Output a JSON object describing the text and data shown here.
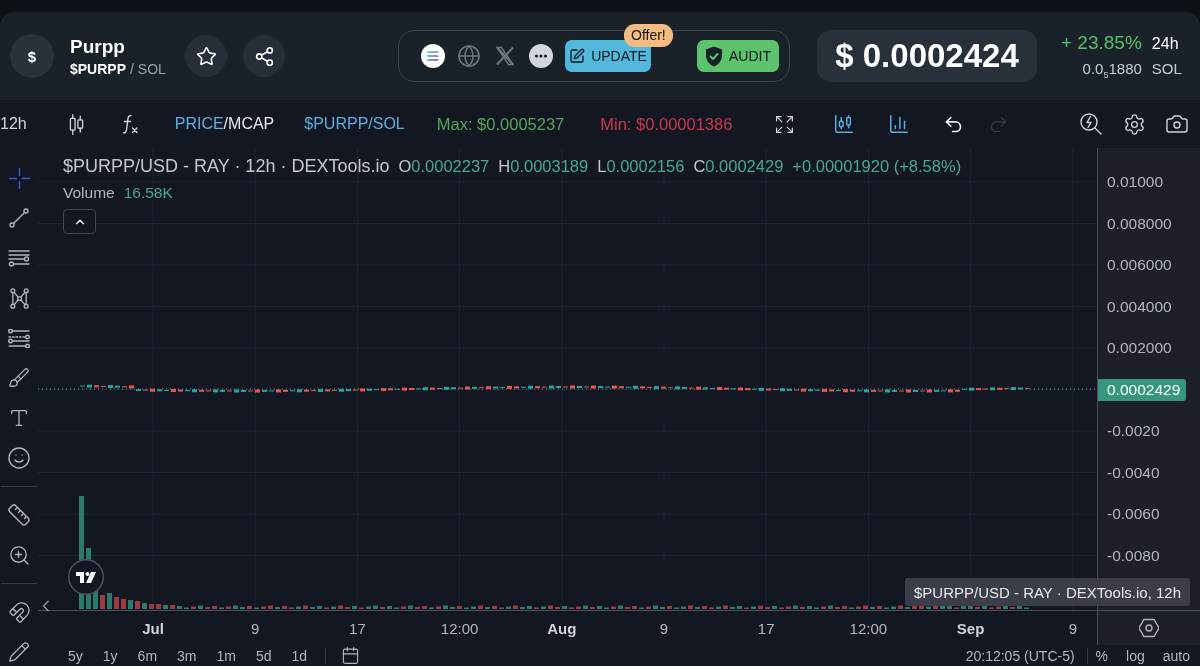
{
  "token": {
    "avatar_text": "$",
    "name": "Purpp",
    "ticker": "$PURPP",
    "quote": "/ SOL"
  },
  "actions": [
    {
      "kind": "update",
      "label": "UPDATE",
      "badge": "Offer!"
    },
    {
      "kind": "audit",
      "label": "AUDIT"
    }
  ],
  "price": {
    "value": "$ 0.0002424",
    "change": "+ 23.85%",
    "period": "24h",
    "native_value": "0.0$_{5}$1880",
    "native_unit": "SOL"
  },
  "toolbar": {
    "interval": "12h",
    "modes": [
      {
        "label": "PRICE",
        "selected": true
      },
      {
        "label": "/MCAP",
        "selected": false
      }
    ],
    "pair": "$PURPP/SOL",
    "max": "Max: $0.0005237",
    "min": "Min: $0.00001386",
    "toggles": [
      {
        "kind": "candles",
        "on": true
      },
      {
        "kind": "volume",
        "on": true
      }
    ],
    "history": [
      {
        "kind": "undo",
        "disabled": false
      },
      {
        "kind": "redo",
        "disabled": true
      }
    ]
  },
  "drawing_tools": [
    [
      {
        "kind": "crosshair",
        "selected": true
      },
      {
        "kind": "trend_line",
        "selected": false
      },
      {
        "kind": "horizontal_lines",
        "selected": false
      },
      {
        "kind": "pattern",
        "selected": false
      },
      {
        "kind": "fib",
        "selected": false
      },
      {
        "kind": "brush",
        "selected": false
      },
      {
        "kind": "text",
        "selected": false
      },
      {
        "kind": "emoji",
        "selected": false
      }
    ],
    [
      {
        "kind": "ruler",
        "selected": false
      },
      {
        "kind": "zoom",
        "selected": false
      }
    ],
    [
      {
        "kind": "magnet",
        "selected": false
      },
      {
        "kind": "pencil",
        "selected": false
      }
    ]
  ],
  "legend": {
    "title": "$PURPP/USD - RAY · 12h · DEXTools.io",
    "ohlc": [
      {
        "label": "O",
        "value": "0.0002237"
      },
      {
        "label": "H",
        "value": "0.0003189"
      },
      {
        "label": "L",
        "value": "0.0002156"
      },
      {
        "label": "C",
        "value": "0.0002429"
      }
    ],
    "change": "+0.00001920 (+8.58%)",
    "volume": {
      "label": "Volume",
      "value": "16.58K"
    }
  },
  "price_axis": [
    {
      "label": "0.01000",
      "kind": "tick"
    },
    {
      "label": "0.008000",
      "kind": "tick"
    },
    {
      "label": "0.006000",
      "kind": "tick"
    },
    {
      "label": "0.004000",
      "kind": "tick"
    },
    {
      "label": "0.002000",
      "kind": "tick"
    },
    {
      "label": "0.0002429",
      "kind": "last_price"
    },
    {
      "label": "-0.0020",
      "kind": "tick"
    },
    {
      "label": "-0.0040",
      "kind": "tick"
    },
    {
      "label": "-0.0060",
      "kind": "tick"
    },
    {
      "label": "-0.0080",
      "kind": "tick"
    }
  ],
  "time_axis": [
    {
      "label": "Jul",
      "kind": "month"
    },
    {
      "label": "9",
      "kind": "tick"
    },
    {
      "label": "17",
      "kind": "tick"
    },
    {
      "label": "12:00",
      "kind": "tick"
    },
    {
      "label": "Aug",
      "kind": "month"
    },
    {
      "label": "9",
      "kind": "tick"
    },
    {
      "label": "17",
      "kind": "tick"
    },
    {
      "label": "12:00",
      "kind": "tick"
    },
    {
      "label": "Sep",
      "kind": "month"
    },
    {
      "label": "9",
      "kind": "tick"
    }
  ],
  "tooltip": "$PURPP/USD - RAY · DEXTools.io, 12h",
  "bottom_bar": {
    "ranges": [
      "5y",
      "1y",
      "6m",
      "3m",
      "1m",
      "5d",
      "1d"
    ],
    "clock": "20:12:05 (UTC-5)",
    "scales": [
      "%",
      "log",
      "auto"
    ]
  }
}
